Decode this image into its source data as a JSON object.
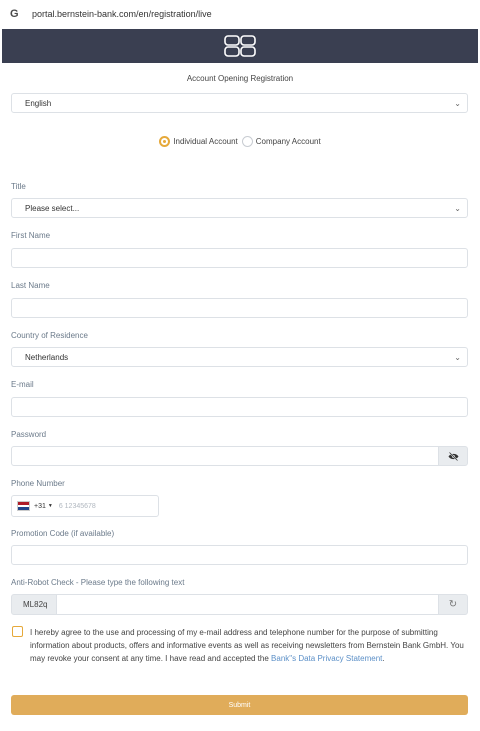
{
  "browser": {
    "url": "portal.bernstein-bank.com/en/registration/live",
    "icon": "G"
  },
  "brand": {
    "logo_name": "bernstein-bank-logo"
  },
  "page": {
    "title": "Account Opening Registration"
  },
  "language_select": {
    "value": "English"
  },
  "account_type": {
    "options": [
      "Individual Account",
      "Company Account"
    ],
    "selected": "Individual Account"
  },
  "fields": {
    "title_label": "Title",
    "title_value": "Please select...",
    "first_name_label": "First Name",
    "last_name_label": "Last Name",
    "country_label": "Country of Residence",
    "country_value": "Netherlands",
    "email_label": "E-mail",
    "password_label": "Password",
    "phone_label": "Phone Number",
    "phone_dial_code": "+31",
    "phone_placeholder": "6 12345678",
    "promo_label": "Promotion Code (if available)",
    "captcha_label": "Anti-Robot Check - Please type the following text",
    "captcha_code": "ML82q"
  },
  "consent": {
    "text": "I hereby agree to the use and processing of my e-mail address and telephone number for the purpose of submitting information about products, offers and informative events as well as receiving newsletters from Bernstein Bank GmbH. You may revoke your consent at any time. I have read and accepted the ",
    "link_text": "Bank\"s Data Privacy Statement",
    "end": "."
  },
  "submit": {
    "label": "Submit"
  },
  "colors": {
    "header_bg": "#3a3f51",
    "accent": "#e6a93a",
    "submit_bg": "#e0ac5a",
    "link": "#5b8fc7"
  },
  "flag": {
    "country": "Netherlands",
    "stripes": [
      "#ae1c28",
      "#ffffff",
      "#21468b"
    ]
  }
}
